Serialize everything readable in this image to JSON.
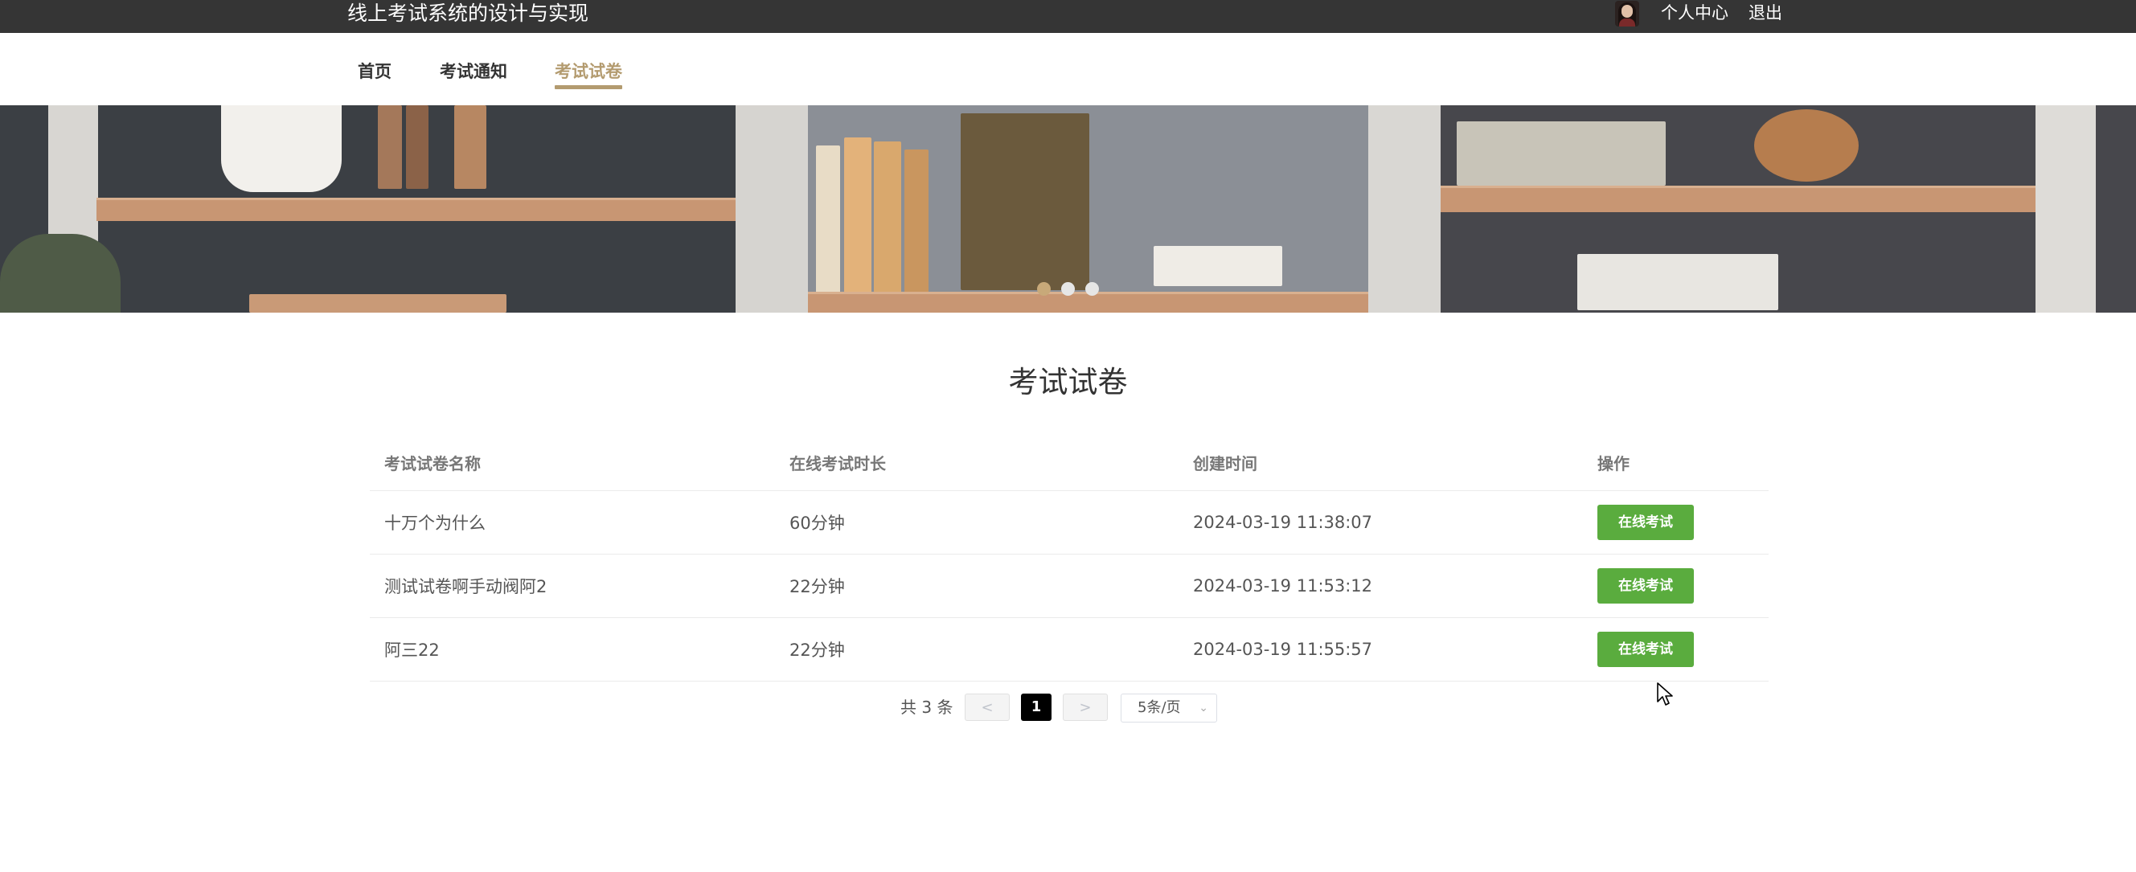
{
  "header": {
    "site_title": "线上考试系统的设计与实现",
    "profile_label": "个人中心",
    "logout_label": "退出"
  },
  "nav": {
    "items": [
      {
        "label": "首页"
      },
      {
        "label": "考试通知"
      },
      {
        "label": "考试试卷"
      }
    ],
    "active_index": 2,
    "active_color": "#b39b6f"
  },
  "carousel": {
    "slide_count": 3,
    "active_index": 0
  },
  "main": {
    "title": "考试试卷",
    "table": {
      "headers": [
        "考试试卷名称",
        "在线考试时长",
        "创建时间",
        "操作"
      ],
      "rows": [
        {
          "name": "十万个为什么",
          "duration": "60分钟",
          "created": "2024-03-19 11:38:07",
          "action": "在线考试"
        },
        {
          "name": "测试试卷啊手动阀阿2",
          "duration": "22分钟",
          "created": "2024-03-19 11:53:12",
          "action": "在线考试"
        },
        {
          "name": "阿三22",
          "duration": "22分钟",
          "created": "2024-03-19 11:55:57",
          "action": "在线考试"
        }
      ],
      "action_color": "#5aac3e"
    }
  },
  "pagination": {
    "total_text": "共 3 条",
    "prev": "<",
    "current_page": "1",
    "next": ">",
    "page_size": "5条/页"
  }
}
